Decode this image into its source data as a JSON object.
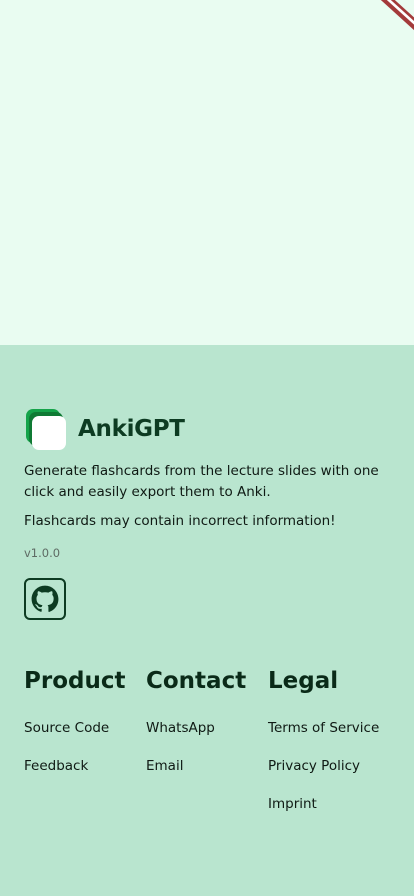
{
  "brand": {
    "name": "AnkiGPT"
  },
  "footer": {
    "description": "Generate flashcards from the lecture slides with one click and easily export them to Anki.",
    "warning": "Flashcards may contain incorrect information!",
    "version": "v1.0.0",
    "github_icon": "github-icon"
  },
  "columns": {
    "product": {
      "title": "Product",
      "links": [
        "Source Code",
        "Feedback"
      ]
    },
    "contact": {
      "title": "Contact",
      "links": [
        "WhatsApp",
        "Email"
      ]
    },
    "legal": {
      "title": "Legal",
      "links": [
        "Terms of Service",
        "Privacy Policy",
        "Imprint"
      ]
    }
  },
  "colors": {
    "top_background": "#e9fcf1",
    "footer_background": "#b9e5cf",
    "brand_dark": "#0d3b22",
    "logo_green": "#15a34a",
    "ribbon_red": "#a33a3a"
  }
}
